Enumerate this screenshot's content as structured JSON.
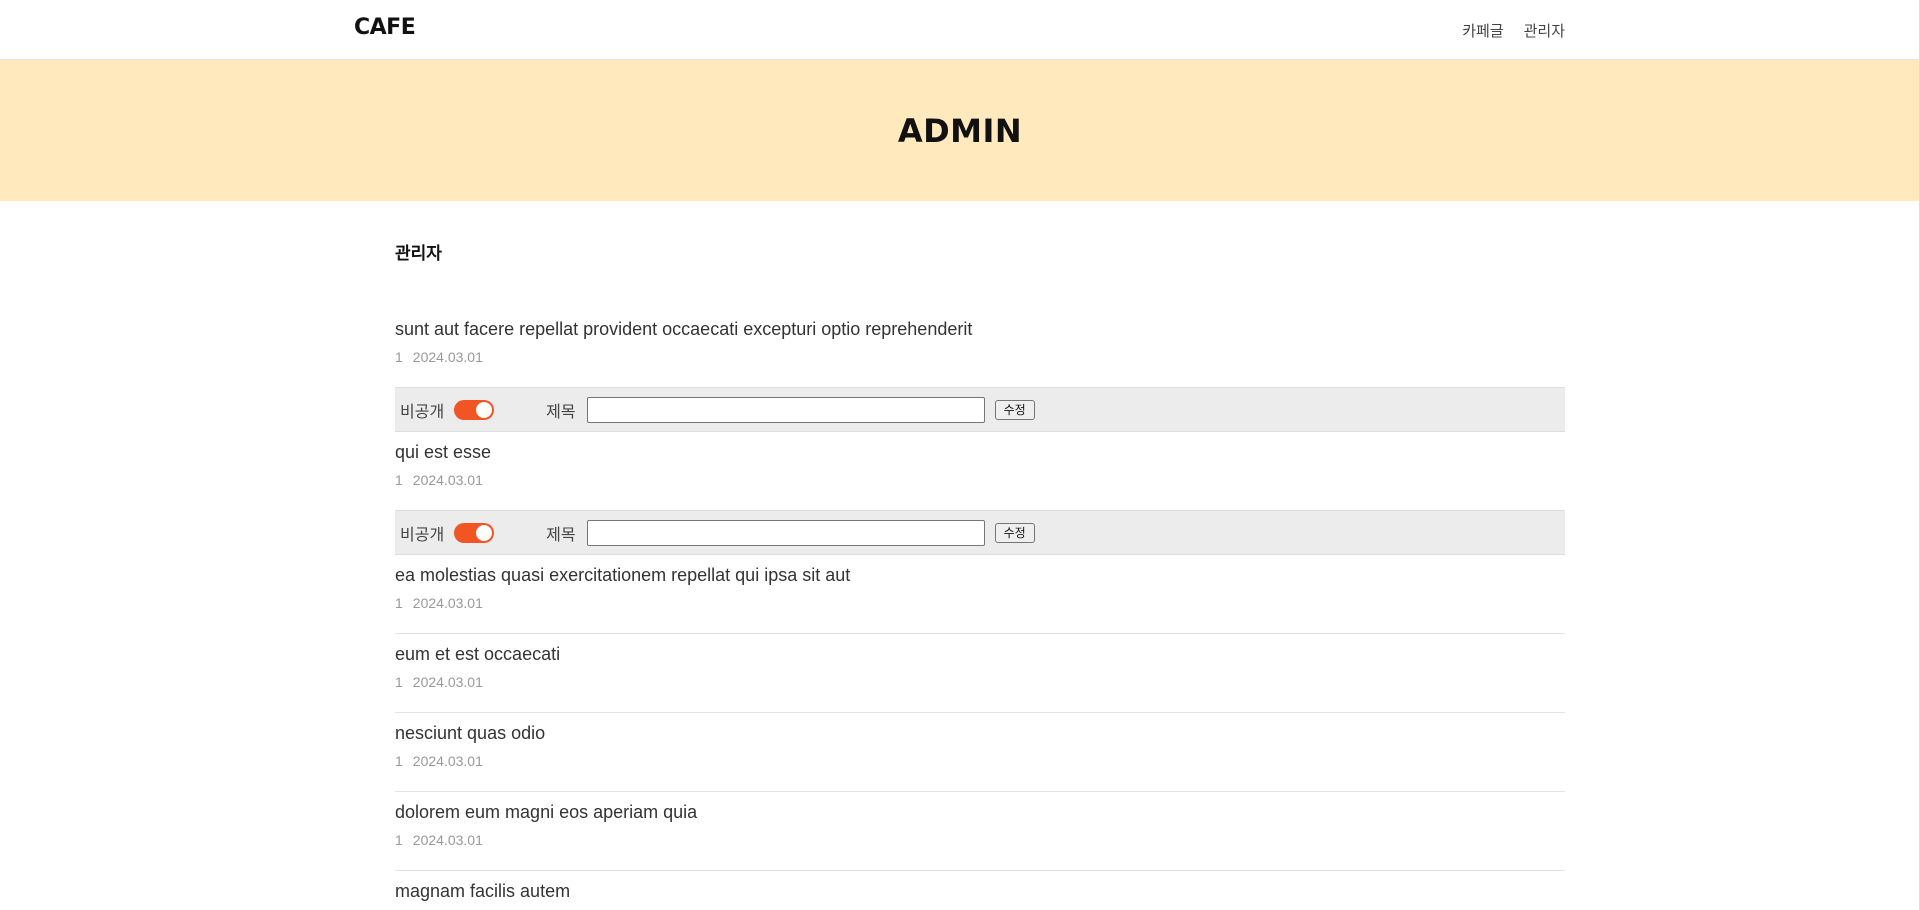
{
  "header": {
    "logo": "CAFE",
    "nav": [
      {
        "label": "카페글"
      },
      {
        "label": "관리자"
      }
    ]
  },
  "banner": {
    "title": "ADMIN"
  },
  "section": {
    "title": "관리자"
  },
  "edit_form": {
    "private_label": "비공개",
    "title_label": "제목",
    "title_value": "",
    "submit_label": "수정",
    "private_toggle_on": true
  },
  "posts": [
    {
      "title": "sunt aut facere repellat provident occaecati excepturi optio reprehenderit",
      "author": "1",
      "date": "2024.03.01",
      "editing": true
    },
    {
      "title": "qui est esse",
      "author": "1",
      "date": "2024.03.01",
      "editing": true
    },
    {
      "title": "ea molestias quasi exercitationem repellat qui ipsa sit aut",
      "author": "1",
      "date": "2024.03.01",
      "editing": false
    },
    {
      "title": "eum et est occaecati",
      "author": "1",
      "date": "2024.03.01",
      "editing": false
    },
    {
      "title": "nesciunt quas odio",
      "author": "1",
      "date": "2024.03.01",
      "editing": false
    },
    {
      "title": "dolorem eum magni eos aperiam quia",
      "author": "1",
      "date": "2024.03.01",
      "editing": false
    },
    {
      "title": "magnam facilis autem",
      "author": "1",
      "date": "2024.03.01",
      "editing": false
    }
  ],
  "colors": {
    "banner_bg": "#ffe9bd",
    "toggle_on": "#f05523",
    "edit_row_bg": "#ececec"
  }
}
